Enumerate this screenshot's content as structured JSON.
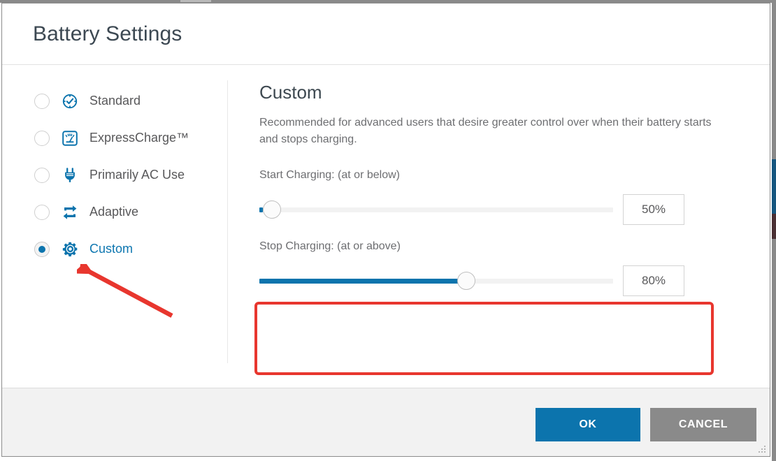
{
  "window": {
    "title": "Battery Settings"
  },
  "modes": [
    {
      "label": "Standard",
      "icon": "clock-check-icon",
      "selected": false
    },
    {
      "label": "ExpressCharge™",
      "icon": "gauge-icon",
      "selected": false
    },
    {
      "label": "Primarily AC Use",
      "icon": "power-plug-icon",
      "selected": false
    },
    {
      "label": "Adaptive",
      "icon": "repeat-arrows-icon",
      "selected": false
    },
    {
      "label": "Custom",
      "icon": "gear-icon",
      "selected": true
    }
  ],
  "detail": {
    "title": "Custom",
    "description": "Recommended for advanced users that desire greater control over when their battery starts and stops charging.",
    "sliders": [
      {
        "label": "Start Charging: (at or below)",
        "value": "50%",
        "fill_percent": 1,
        "thumb_percent": 1
      },
      {
        "label": "Stop Charging: (at or above)",
        "value": "80%",
        "fill_percent": 59,
        "thumb_percent": 59
      }
    ]
  },
  "footer": {
    "ok_label": "OK",
    "cancel_label": "CANCEL"
  },
  "colors": {
    "accent_blue": "#0c74ad",
    "link_blue": "#0d76b0",
    "annotation_red": "#e8362e",
    "cancel_grey": "#8a8a8a",
    "footer_bg": "#f2f2f2",
    "title_text": "#3c4852",
    "body_text": "#6d6e71"
  }
}
